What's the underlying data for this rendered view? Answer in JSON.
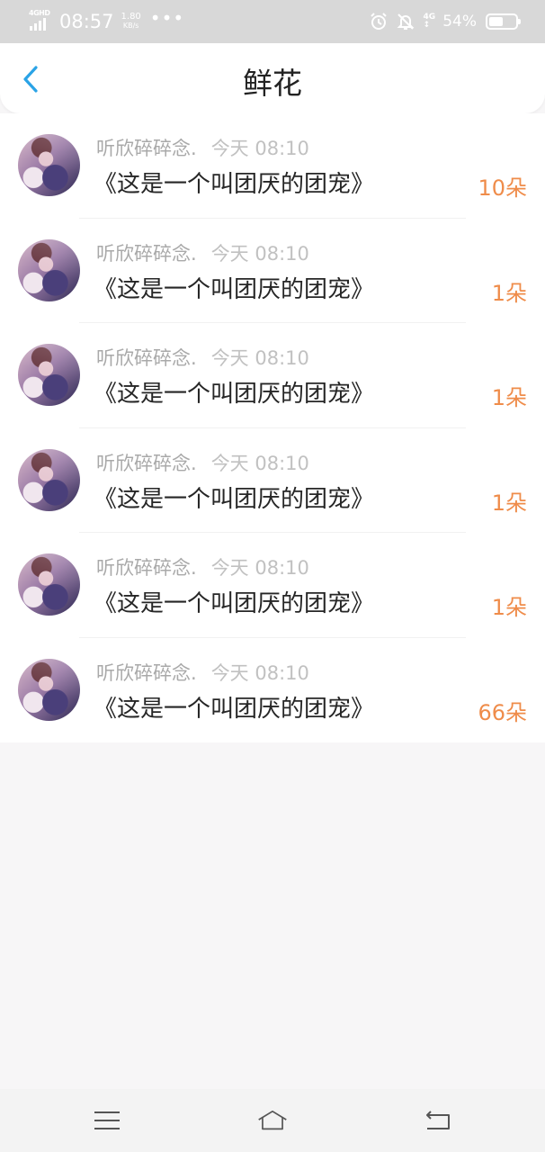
{
  "status_bar": {
    "network_type": "4GHD",
    "time": "08:57",
    "speed_value": "1.80",
    "speed_unit": "KB/s",
    "more": "•••",
    "net_right_top": "4G",
    "net_right_bottom": "↕",
    "battery_percent": "54%",
    "battery_level": 0.54,
    "icons": [
      "signal-icon",
      "alarm-icon",
      "mute-bell-icon",
      "battery-icon"
    ]
  },
  "header": {
    "title": "鲜花",
    "back_icon": "chevron-left-icon",
    "accent_color": "#2aa3e6"
  },
  "colors": {
    "flower_count": "#ef8c4a",
    "meta_text": "#a9a9a9",
    "title_text": "#262626"
  },
  "items": [
    {
      "user": "听欣碎碎念.",
      "time": "今天 08:10",
      "title": "《这是一个叫团厌的团宠》",
      "flowers": "10朵"
    },
    {
      "user": "听欣碎碎念.",
      "time": "今天 08:10",
      "title": "《这是一个叫团厌的团宠》",
      "flowers": "1朵"
    },
    {
      "user": "听欣碎碎念.",
      "time": "今天 08:10",
      "title": "《这是一个叫团厌的团宠》",
      "flowers": "1朵"
    },
    {
      "user": "听欣碎碎念.",
      "time": "今天 08:10",
      "title": "《这是一个叫团厌的团宠》",
      "flowers": "1朵"
    },
    {
      "user": "听欣碎碎念.",
      "time": "今天 08:10",
      "title": "《这是一个叫团厌的团宠》",
      "flowers": "1朵"
    },
    {
      "user": "听欣碎碎念.",
      "time": "今天 08:10",
      "title": "《这是一个叫团厌的团宠》",
      "flowers": "66朵"
    }
  ],
  "nav_bar": {
    "icons": [
      "menu-icon",
      "home-icon",
      "back-icon"
    ]
  }
}
